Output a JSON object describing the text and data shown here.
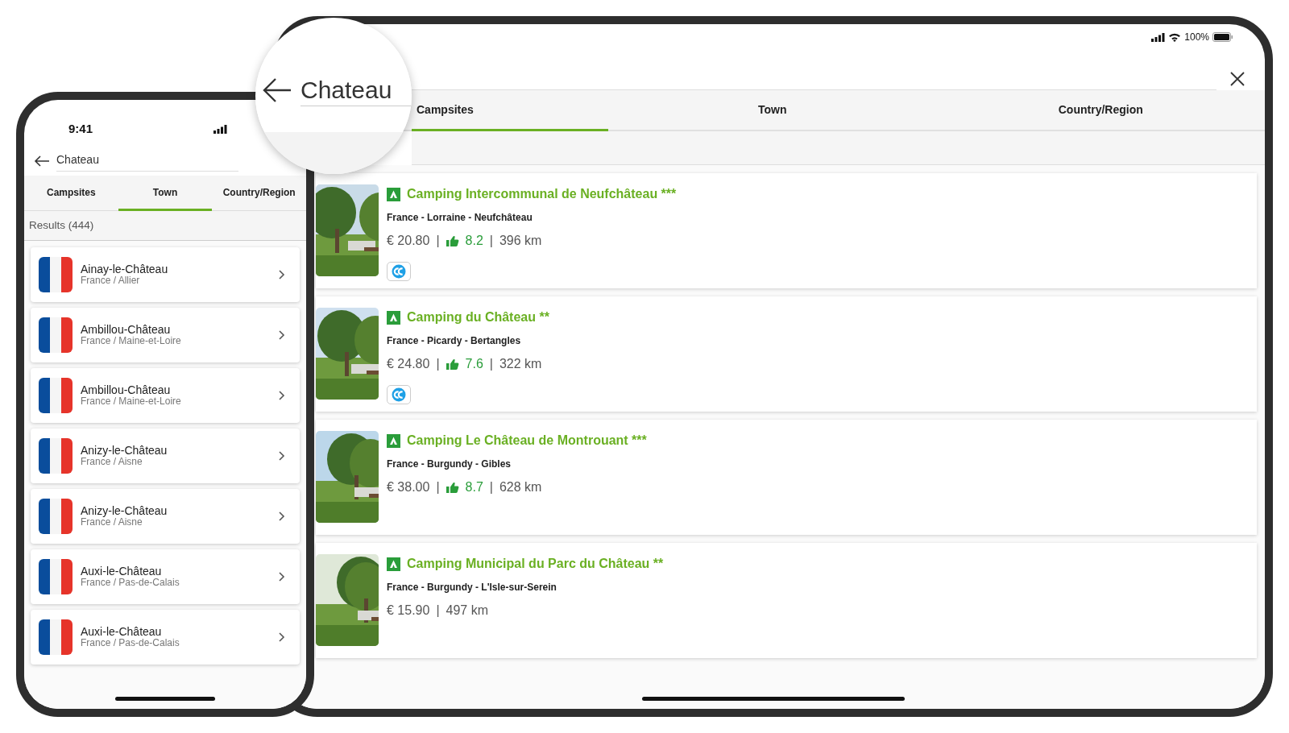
{
  "tablet": {
    "status_bar": {
      "battery": "100%"
    },
    "search": {
      "value": "Chateau"
    },
    "tabs": [
      {
        "label": "Campsites",
        "selected": true
      },
      {
        "label": "Town",
        "selected": false
      },
      {
        "label": "Country/Region",
        "selected": false
      }
    ],
    "campsites": [
      {
        "name": "Camping Intercommunal de Neufchâteau ***",
        "location": "France  - Lorraine - Neufchâteau",
        "price": "€ 20.80",
        "separators": [
          "|",
          "|"
        ],
        "rating": "8.2",
        "distance": "396 km",
        "cc_badge": true
      },
      {
        "name": "Camping du Château **",
        "location": "France  - Picardy - Bertangles",
        "price": "€ 24.80",
        "separators": [
          "|",
          "|"
        ],
        "rating": "7.6",
        "distance": "322 km",
        "cc_badge": true
      },
      {
        "name": "Camping Le Château de Montrouant ***",
        "location": "France  - Burgundy - Gibles",
        "price": "€ 38.00",
        "separators": [
          "|",
          "|"
        ],
        "rating": "8.7",
        "distance": "628 km",
        "cc_badge": false
      },
      {
        "name": "Camping Municipal du Parc du Château **",
        "location": "France  - Burgundy - L'Isle-sur-Serein",
        "price": "€ 15.90",
        "separators": [
          "|"
        ],
        "distance": "497 km",
        "cc_badge": false
      }
    ]
  },
  "phone": {
    "status_bar": {
      "time": "9:41"
    },
    "search": {
      "value": "Chateau"
    },
    "tabs": [
      {
        "label": "Campsites",
        "selected": false
      },
      {
        "label": "Town",
        "selected": true
      },
      {
        "label": "Country/Region",
        "selected": false
      }
    ],
    "results_label": "Results (444)",
    "towns": [
      {
        "name": "Ainay-le-Château",
        "region": "France / Allier"
      },
      {
        "name": "Ambillou-Château",
        "region": "France / Maine-et-Loire"
      },
      {
        "name": "Ambillou-Château",
        "region": "France / Maine-et-Loire"
      },
      {
        "name": "Anizy-le-Château",
        "region": "France / Aisne"
      },
      {
        "name": "Anizy-le-Château",
        "region": "France / Aisne"
      },
      {
        "name": "Auxi-le-Château",
        "region": "France / Pas-de-Calais"
      },
      {
        "name": "Auxi-le-Château",
        "region": "France / Pas-de-Calais"
      }
    ]
  }
}
